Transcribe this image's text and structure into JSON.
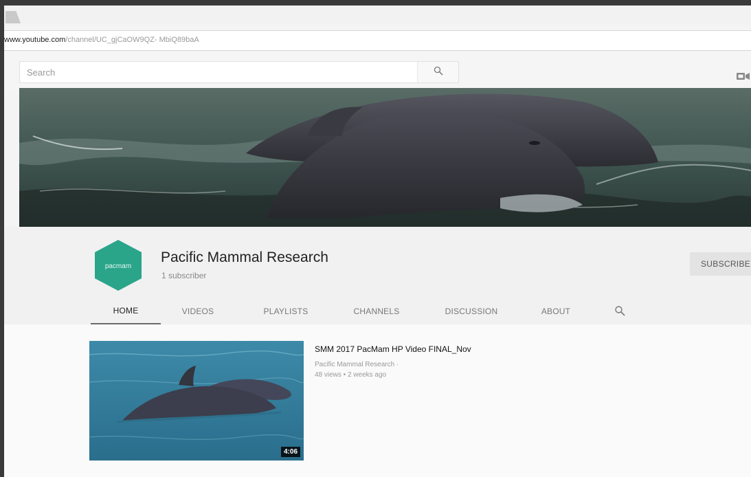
{
  "browser": {
    "url_main": "www.youtube.com",
    "url_path": "/channel/UC_gjCaOW9QZ- MbiQ89baA"
  },
  "header": {
    "search_placeholder": "Search"
  },
  "channel": {
    "name": "Pacific Mammal Research",
    "subscribers": "1 subscriber",
    "subscribe_label": "SUBSCRIBE",
    "avatar_text": "pacmam",
    "avatar_color": "#2aa58a"
  },
  "tabs": [
    {
      "label": "HOME",
      "active": true
    },
    {
      "label": "VIDEOS",
      "active": false
    },
    {
      "label": "PLAYLISTS",
      "active": false
    },
    {
      "label": "CHANNELS",
      "active": false
    },
    {
      "label": "DISCUSSION",
      "active": false
    },
    {
      "label": "ABOUT",
      "active": false
    }
  ],
  "video": {
    "title": "SMM 2017 PacMam HP Video FINAL_Nov",
    "channel": "Pacific Mammal Research ·",
    "stats": "48 views • 2 weeks ago",
    "duration": "4:06"
  },
  "icons": {
    "search": "search-icon",
    "upload": "video-camera-icon",
    "channel_search": "search-icon"
  }
}
